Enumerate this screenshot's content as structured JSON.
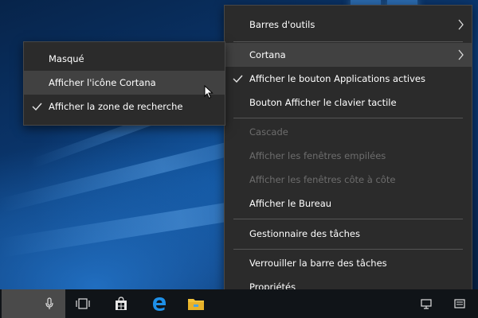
{
  "main_menu": {
    "items": [
      {
        "label": "Barres d'outils",
        "submenu": true
      },
      {
        "label": "Cortana",
        "submenu": true
      },
      {
        "label": "Afficher le bouton Applications actives",
        "checked": true
      },
      {
        "label": "Bouton Afficher le clavier tactile"
      },
      {
        "label": "Cascade",
        "disabled": true
      },
      {
        "label": "Afficher les fenêtres empilées",
        "disabled": true
      },
      {
        "label": "Afficher les fenêtres côte à côte",
        "disabled": true
      },
      {
        "label": "Afficher le Bureau"
      },
      {
        "label": "Gestionnaire des tâches"
      },
      {
        "label": "Verrouiller la barre des tâches"
      },
      {
        "label": "Propriétés"
      }
    ]
  },
  "cortana_submenu": {
    "items": [
      {
        "label": "Masqué"
      },
      {
        "label": "Afficher l'icône Cortana",
        "hovered": true
      },
      {
        "label": "Afficher la zone de recherche",
        "checked": true
      }
    ]
  },
  "taskbar": {
    "icons": [
      "microphone-icon",
      "task-view-icon",
      "store-icon",
      "edge-icon",
      "file-explorer-icon"
    ]
  },
  "colors": {
    "menu_bg": "#2b2b2b",
    "menu_hover": "#414141",
    "disabled_text": "#6d6d6d",
    "taskbar_bg": "#101418",
    "edge_blue": "#1e90e8",
    "explorer_yellow": "#f3c33a"
  }
}
